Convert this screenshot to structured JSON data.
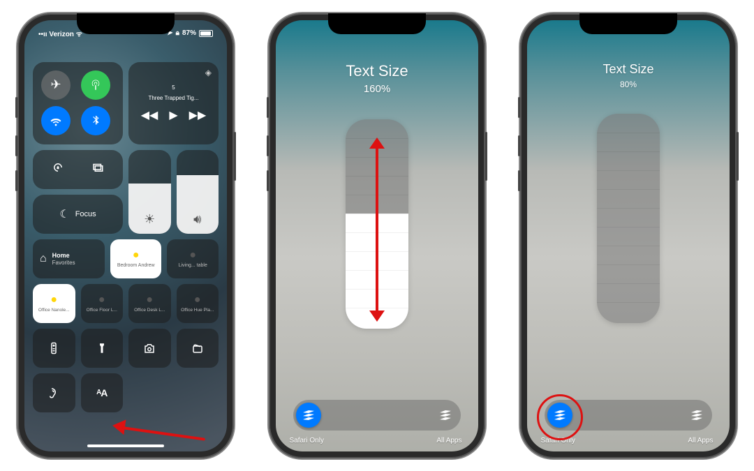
{
  "status": {
    "carrier": "Verizon",
    "signal_bars": "••ıı",
    "battery_pct": "87%",
    "location_icon": "location-arrow"
  },
  "media": {
    "track_count": "5",
    "track_name": "Three Trapped Tig..."
  },
  "focus": {
    "label": "Focus"
  },
  "home": {
    "title": "Home",
    "subtitle": "Favorites",
    "tiles": [
      {
        "label": "Bedroom Andrew"
      },
      {
        "label": "Living... table"
      }
    ]
  },
  "devices": [
    {
      "label": "Office Nanole..."
    },
    {
      "label": "Office Floor L..."
    },
    {
      "label": "Office Desk L..."
    },
    {
      "label": "Office Hue Pla..."
    }
  ],
  "textsize": {
    "title": "Text Size",
    "pct_1": "160%",
    "pct_2": "80%",
    "safari_only": "Safari Only",
    "all_apps": "All Apps"
  },
  "textsize_button_label": "AA"
}
